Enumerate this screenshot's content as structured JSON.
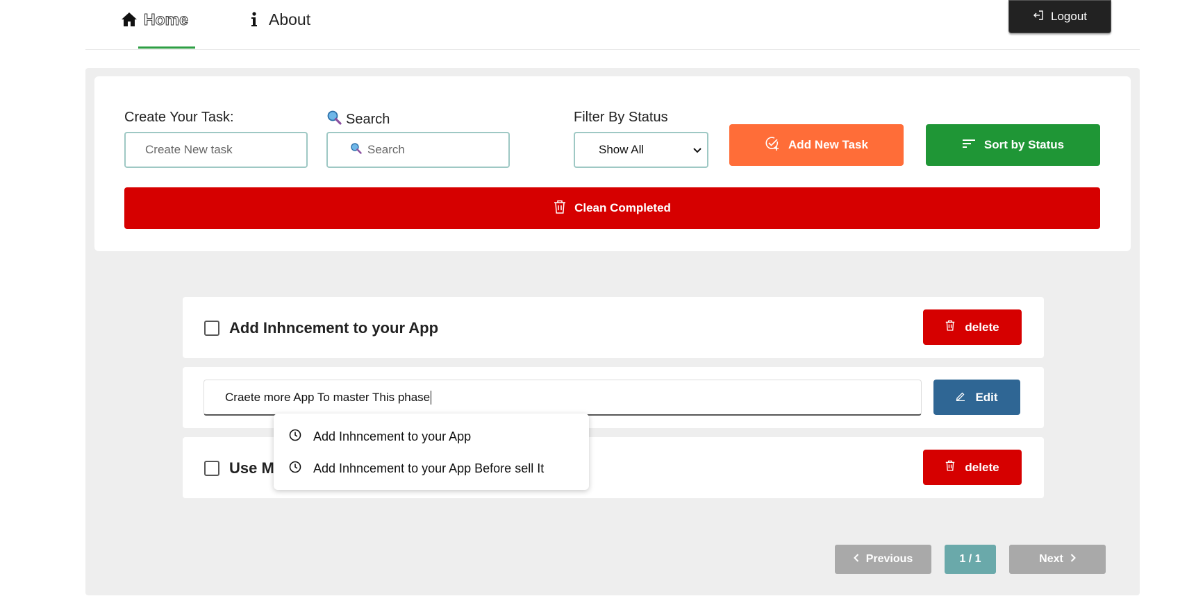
{
  "nav": {
    "home_label": "Home",
    "about_label": "About",
    "logout_label": "Logout"
  },
  "controls": {
    "create_label": "Create Your Task:",
    "create_placeholder": "Create New task",
    "search_label": "Search",
    "search_placeholder": "Search",
    "filter_label": "Filter By Status",
    "filter_selected": "Show All",
    "add_button": "Add New Task",
    "sort_button": "Sort by Status",
    "clean_button": "Clean Completed"
  },
  "tasks": [
    {
      "title": "Add Inhncement to your App",
      "completed": false,
      "action_label": "delete"
    },
    {
      "editing": true,
      "edit_value": "Craete more App To master This phase",
      "action_label": "Edit"
    },
    {
      "title": "Use M",
      "completed": false,
      "action_label": "delete"
    }
  ],
  "suggestions": [
    "Add Inhncement to your App",
    "Add Inhncement to your App Before sell It"
  ],
  "pagination": {
    "previous_label": "Previous",
    "page_indicator": "1 / 1",
    "next_label": "Next"
  },
  "colors": {
    "accent_green": "#1f9636",
    "add_orange": "#ff6d38",
    "danger_red": "#d60000",
    "edit_blue": "#2f6694"
  }
}
